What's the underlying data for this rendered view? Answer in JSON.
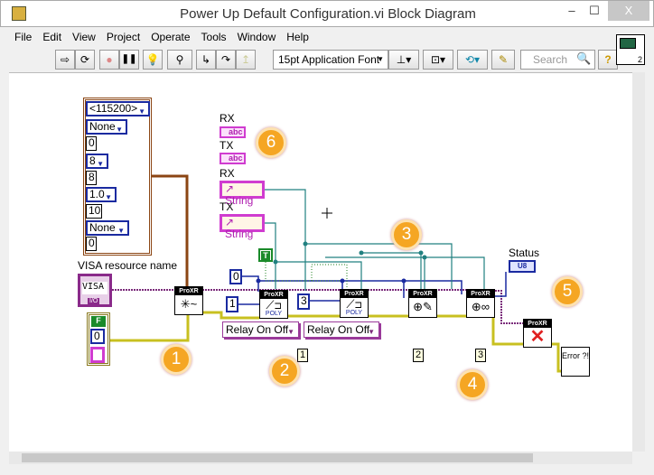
{
  "window": {
    "title": "Power Up Default Configuration.vi Block Diagram",
    "minimize": "–",
    "maximize": "☐",
    "close": "X"
  },
  "menu": [
    "File",
    "Edit",
    "View",
    "Project",
    "Operate",
    "Tools",
    "Window",
    "Help"
  ],
  "toolbar": {
    "run": "⇨",
    "run_continuously": "⟳",
    "abort": "●",
    "pause": "❚❚",
    "highlight": "💡",
    "retain": "⚲",
    "step_into": "↳",
    "step_over": "↷",
    "step_out": "↥",
    "font": "15pt Application Font",
    "align": "⊥▾",
    "distribute": "⊡▾",
    "reorder": "⟲▾",
    "cleanup": "✎",
    "search_placeholder": "Search",
    "help": "?",
    "connector_num": "2"
  },
  "diagram": {
    "cluster": [
      "<115200>",
      "None",
      "0",
      "8",
      "8",
      "1.0",
      "10",
      "None",
      "0"
    ],
    "visa_label": "VISA resource name",
    "visa_value": "VISA",
    "visa_io": "I/O",
    "error_bool": "F",
    "error_code": "0",
    "rx_label_1": "RX",
    "tx_label_1": "TX",
    "ind_text": "abc",
    "rx_label_2": "RX",
    "tx_label_2": "TX",
    "string_text": "String",
    "true_const": "T",
    "const_0": "0",
    "const_1": "1",
    "const_3": "3",
    "node_header": "ProXR",
    "poly": "POLY",
    "relay_enum_1": "Relay On Off",
    "relay_enum_2": "Relay On Off",
    "frames": [
      "1",
      "2",
      "3"
    ],
    "status_label": "Status",
    "status_type": "U8",
    "error_handler": "Error ?!",
    "badges": [
      "1",
      "2",
      "3",
      "4",
      "5",
      "6"
    ]
  },
  "colors": {
    "visa_wire": "#7a2a7a",
    "error_wire": "#c8c020",
    "cluster_wire": "#8b4513",
    "int_wire": "#1a2aa0",
    "string_wire": "#208080",
    "badge": "#f5a623"
  }
}
